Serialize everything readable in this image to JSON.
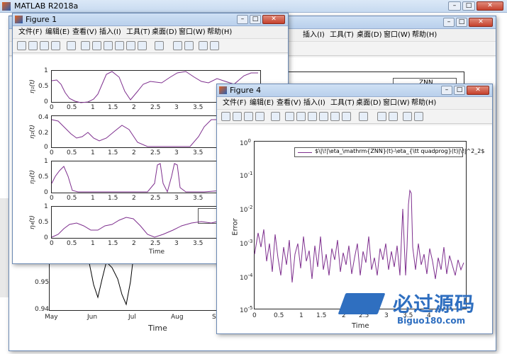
{
  "app": {
    "title": "MATLAB R2018a"
  },
  "figure1": {
    "title": "Figure 1",
    "menu": [
      "文件(F)",
      "编辑(E)",
      "查看(V)",
      "插入(I)",
      "工具(T)",
      "桌面(D)",
      "窗口(W)",
      "帮助(H)"
    ],
    "xticks": [
      "0",
      "0.5",
      "1",
      "1.5",
      "2",
      "2.5",
      "3",
      "3.5"
    ],
    "xlabel": "Time",
    "subplots": [
      {
        "ylabel": "η₁(t)",
        "yticks": [
          "1",
          "0.5",
          "0"
        ]
      },
      {
        "ylabel": "η₂(t)",
        "yticks": [
          "0.4",
          "0.2",
          "0"
        ]
      },
      {
        "ylabel": "η₃(t)",
        "yticks": [
          "1",
          "0.5",
          "0"
        ]
      },
      {
        "ylabel": "η₄(t)",
        "yticks": [
          "1",
          "0.5",
          "0"
        ]
      }
    ]
  },
  "figure4": {
    "title": "Figure 4",
    "menu": [
      "文件(F)",
      "编辑(E)",
      "查看(V)",
      "插入(I)",
      "工具(T)",
      "桌面(D)",
      "窗口(W)",
      "帮助(H)"
    ],
    "legend": "$\\|\\!|\\eta_\\mathrm{ZNN}(t)-\\eta_{\\tt quadprog}(t)|\\!|^2_2$",
    "ylabel": "Error",
    "xlabel": "Time",
    "xticks": [
      "0",
      "0.5",
      "1",
      "1.5",
      "2",
      "2.5",
      "3",
      "3.5",
      "4"
    ],
    "yticks": [
      {
        "base": "10",
        "exp": "0"
      },
      {
        "base": "10",
        "exp": "-1"
      },
      {
        "base": "10",
        "exp": "-2"
      },
      {
        "base": "10",
        "exp": "-3"
      },
      {
        "base": "10",
        "exp": "-4"
      },
      {
        "base": "10",
        "exp": "-5"
      }
    ]
  },
  "back_figure": {
    "menu": [
      "插入(I)",
      "工具(T)",
      "桌面(D)",
      "窗口(W)",
      "帮助(H)"
    ],
    "legend": "ZNN",
    "xticks": [
      "May",
      "Jun",
      "Jul",
      "Aug",
      "Se"
    ],
    "yticks": [
      "0.95",
      "0.94"
    ],
    "xlabel": "Time"
  },
  "watermark": {
    "text": "必过源码",
    "url": "Biguo180.com"
  },
  "colors": {
    "line": "#7e2f8e",
    "accent_blue": "#2f6fc0"
  }
}
